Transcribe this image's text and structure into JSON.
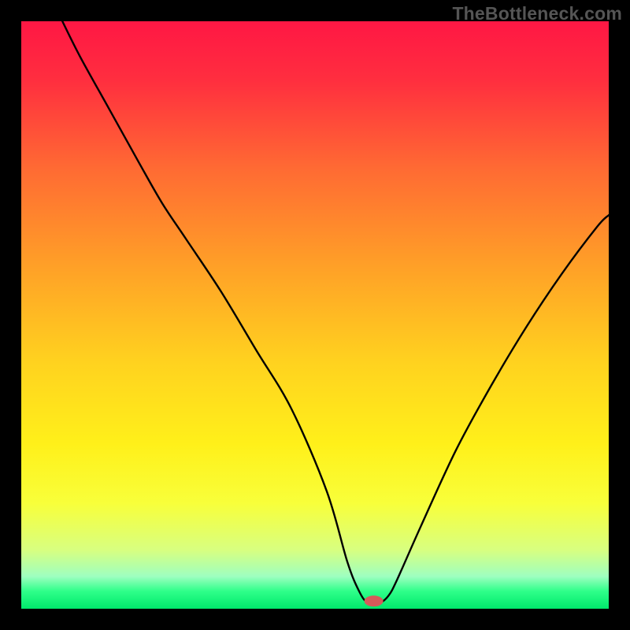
{
  "watermark": "TheBottleneck.com",
  "chart_data": {
    "type": "line",
    "title": "",
    "xlabel": "",
    "ylabel": "",
    "xlim": [
      0,
      100
    ],
    "ylim": [
      0,
      100
    ],
    "background_gradient": {
      "stops": [
        {
          "offset": 0.0,
          "color": "#ff1744"
        },
        {
          "offset": 0.1,
          "color": "#ff2e3f"
        },
        {
          "offset": 0.25,
          "color": "#ff6a33"
        },
        {
          "offset": 0.42,
          "color": "#ffa127"
        },
        {
          "offset": 0.58,
          "color": "#ffd21f"
        },
        {
          "offset": 0.72,
          "color": "#fff01a"
        },
        {
          "offset": 0.82,
          "color": "#f8ff3a"
        },
        {
          "offset": 0.9,
          "color": "#d8ff80"
        },
        {
          "offset": 0.945,
          "color": "#9effc0"
        },
        {
          "offset": 0.97,
          "color": "#2fff8a"
        },
        {
          "offset": 1.0,
          "color": "#00e86b"
        }
      ]
    },
    "series": [
      {
        "name": "bottleneck-curve",
        "x": [
          7,
          10,
          15,
          20,
          24,
          28,
          34,
          40,
          46,
          52,
          55.5,
          57.5,
          59,
          61,
          62.5,
          64,
          68,
          74,
          80,
          86,
          92,
          98,
          100
        ],
        "y": [
          100,
          94,
          85,
          76,
          69,
          63,
          54,
          44,
          34,
          20,
          8,
          3,
          1,
          1,
          2.2,
          5,
          14,
          27,
          38,
          48,
          57,
          65,
          67
        ]
      }
    ],
    "marker": {
      "name": "minimum-marker",
      "x": 60,
      "y": 1.3,
      "color": "#d65a5a",
      "rx": 12,
      "ry": 7
    }
  }
}
